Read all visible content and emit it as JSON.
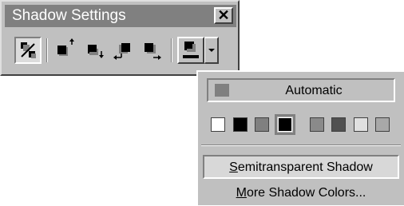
{
  "window": {
    "title": "Shadow Settings",
    "close_label": "✕"
  },
  "toolbar": {
    "buttons": [
      {
        "name": "shadow-on-off-icon",
        "state": "pressed"
      },
      {
        "name": "nudge-shadow-up-icon",
        "state": "normal"
      },
      {
        "name": "nudge-shadow-down-icon",
        "state": "normal"
      },
      {
        "name": "nudge-shadow-left-icon",
        "state": "normal"
      },
      {
        "name": "nudge-shadow-right-icon",
        "state": "normal"
      },
      {
        "name": "shadow-color-icon",
        "state": "raised"
      }
    ]
  },
  "dropdown": {
    "automatic_label": "Automatic",
    "automatic_color": "#808080",
    "colors": [
      "#ffffff",
      "#000000",
      "#808080",
      "#000000",
      "#8a8a8a",
      "#505050",
      "#e0e0e0",
      "#a8a8a8"
    ],
    "selected_index": 3,
    "semitransparent_label": "Semitransparent Shadow",
    "semitransparent_mnemonic": "S",
    "more_colors_label": "More Shadow Colors...",
    "more_colors_mnemonic": "M"
  }
}
